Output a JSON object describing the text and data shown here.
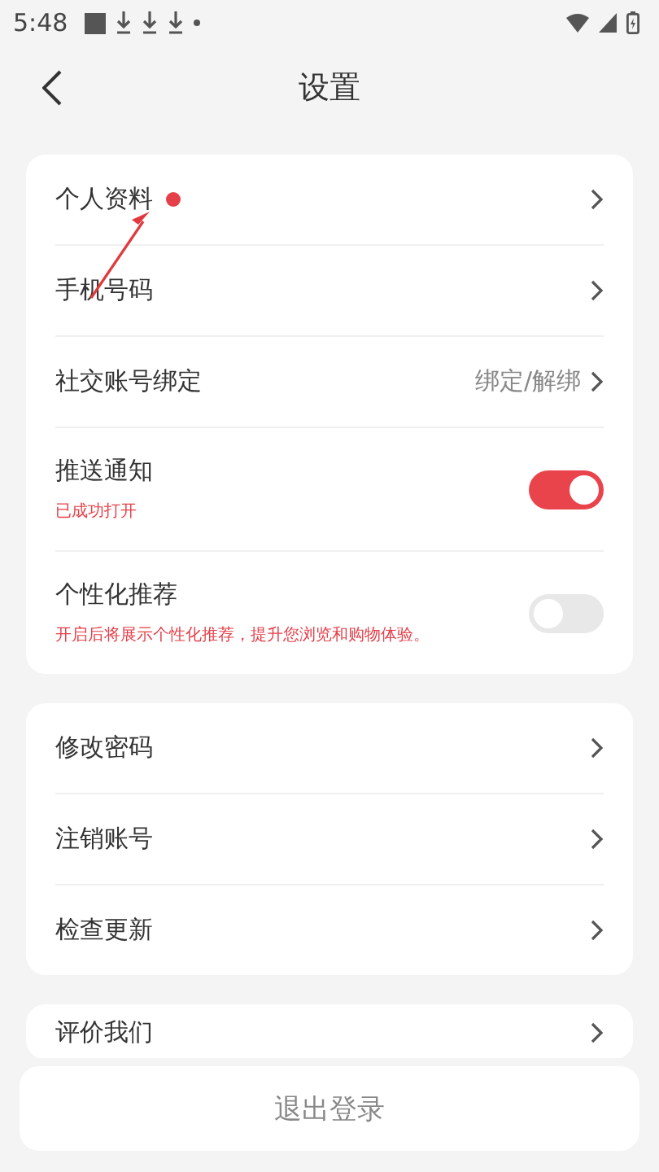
{
  "status_bar": {
    "time": "5:48"
  },
  "header": {
    "title": "设置"
  },
  "groups": [
    {
      "items": [
        {
          "kind": "link",
          "label": "个人资料",
          "dot": true
        },
        {
          "kind": "link",
          "label": "手机号码",
          "dot": false
        },
        {
          "kind": "link",
          "label": "社交账号绑定",
          "value": "绑定/解绑",
          "dot": false
        },
        {
          "kind": "toggle",
          "label": "推送通知",
          "note": "已成功打开",
          "on": true
        },
        {
          "kind": "toggle",
          "label": "个性化推荐",
          "note": "开启后将展示个性化推荐，提升您浏览和购物体验。",
          "on": false
        }
      ]
    },
    {
      "items": [
        {
          "kind": "link",
          "label": "修改密码",
          "dot": false
        },
        {
          "kind": "link",
          "label": "注销账号",
          "dot": false
        },
        {
          "kind": "link",
          "label": "检查更新",
          "dot": false
        }
      ]
    },
    {
      "items": [
        {
          "kind": "link",
          "label": "评价我们",
          "dot": false
        }
      ]
    }
  ],
  "logout_button": "退出登录"
}
